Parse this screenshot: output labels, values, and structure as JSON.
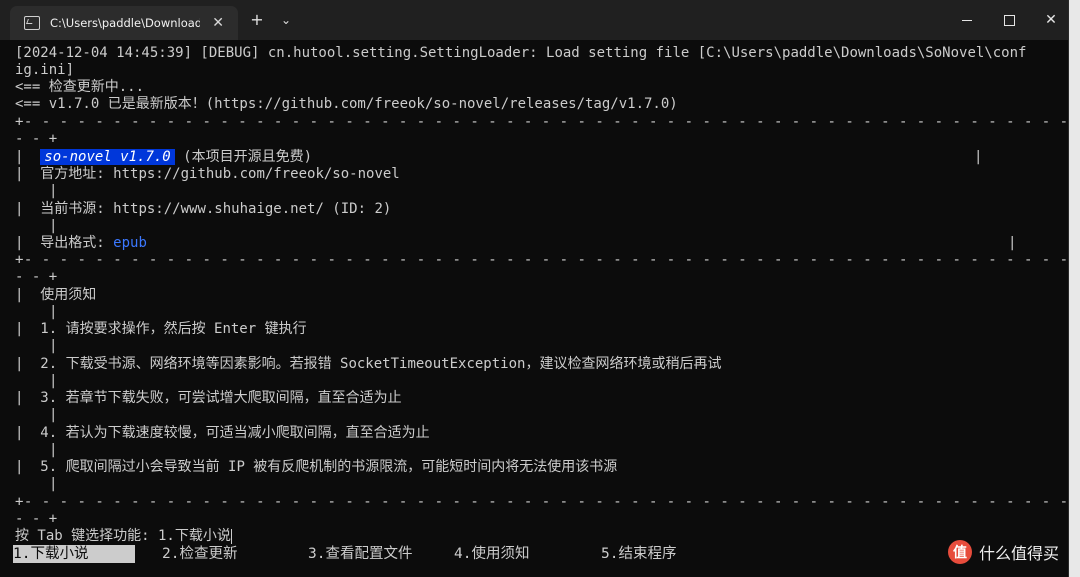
{
  "tab": {
    "title": "C:\\Users\\paddle\\Downloads\\S",
    "close_glyph": "✕"
  },
  "toolbar": {
    "new_tab_glyph": "+",
    "dropdown_glyph": "⌄"
  },
  "window_controls": {
    "close_glyph": "✕"
  },
  "terminal": {
    "log_line_1": "[2024-12-04 14:45:39] [DEBUG] cn.hutool.setting.SettingLoader: Load setting file [C:\\Users\\paddle\\Downloads\\SoNovel\\conf",
    "log_line_2": "ig.ini]",
    "update_check": "<== 检查更新中...",
    "update_result": "<== v1.7.0 已是最新版本！(https://github.com/freeok/so-novel/releases/tag/v1.7.0)",
    "border_row": "+- - - - - - - - - - - - - - - - - - - - - - - - - - - - - - - - - - - - - - - - - - - - - - - - - - - - - - - - - - - - - - - -",
    "border_tail": "- - +",
    "app_name": "so-novel v1.7.0",
    "app_note": "(本项目开源且免费)",
    "website": "官方地址: https://github.com/freeok/so-novel",
    "source": "当前书源: https://www.shuhaige.net/ (ID: 2)",
    "export_label": "导出格式: ",
    "export_value": "epub",
    "notice_title": "使用须知",
    "notices": [
      "1. 请按要求操作，然后按 Enter 键执行",
      "2. 下载受书源、网络环境等因素影响。若报错 SocketTimeoutException，建议检查网络环境或稍后再试",
      "3. 若章节下载失败，可尝试增大爬取间隔，直至合适为止",
      "4. 若认为下载速度较慢，可适当减小爬取间隔，直至合适为止",
      "5. 爬取间隔过小会导致当前 IP 被有反爬机制的书源限流，可能短时间内将无法使用该书源"
    ],
    "prompt": "按 Tab 键选择功能: 1.下载小说",
    "menu": [
      "1.下载小说",
      "2.检查更新",
      "3.查看配置文件",
      "4.使用须知",
      "5.结束程序"
    ]
  },
  "watermark": {
    "logo_glyph": "值",
    "text": "什么值得买"
  }
}
